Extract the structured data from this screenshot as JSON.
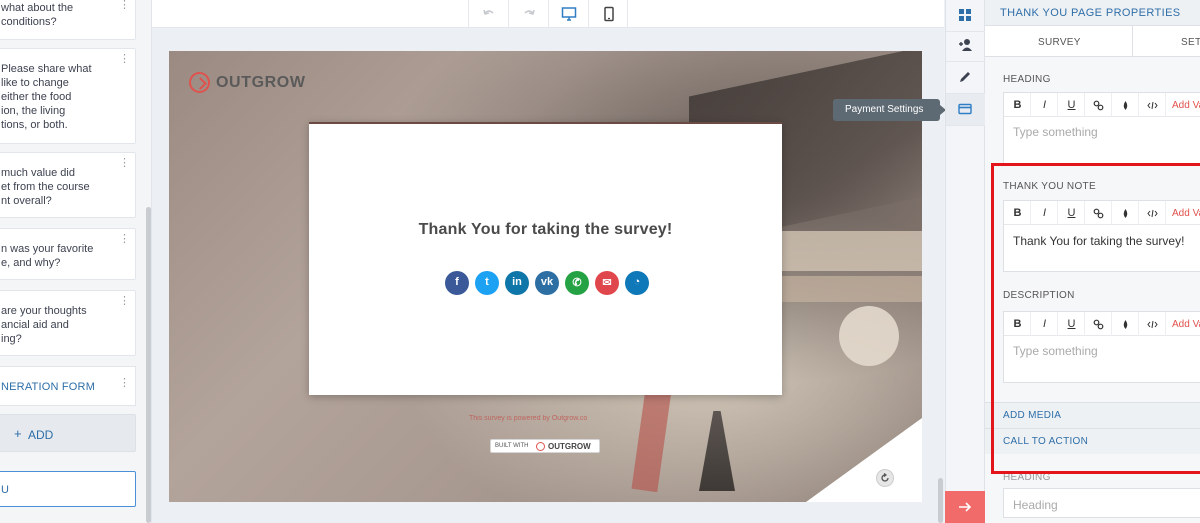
{
  "questions": [
    {
      "text": "what about the\nconditions?"
    },
    {
      "text": "Please share what\nlike to change\neither the food\nion, the living\ntions, or both."
    },
    {
      "text": "much value did\net from the course\nnt overall?"
    },
    {
      "text": "n was your favorite\ne, and why?"
    },
    {
      "text": "are your thoughts\nancial aid and\ning?"
    }
  ],
  "lead_gen_label": "NERATION FORM",
  "add_button": {
    "plus": "+",
    "label": "ADD"
  },
  "thank_field_label": "U",
  "toolbar": {
    "icons": [
      "undo-icon",
      "redo-icon",
      "desktop-icon",
      "mobile-icon"
    ]
  },
  "preview": {
    "brand": "OUTGROW",
    "title": "Thank You for taking the survey!",
    "share_buttons": [
      {
        "name": "facebook",
        "glyph": "f",
        "color": "#3b5998"
      },
      {
        "name": "twitter",
        "glyph": "t",
        "color": "#1da1f2"
      },
      {
        "name": "linkedin",
        "glyph": "in",
        "color": "#0e76a8"
      },
      {
        "name": "vk",
        "glyph": "vk",
        "color": "#2d6ea3"
      },
      {
        "name": "whatsapp",
        "glyph": "✆",
        "color": "#25a244"
      },
      {
        "name": "email",
        "glyph": "✉",
        "color": "#e0474c"
      },
      {
        "name": "messenger",
        "glyph": "◔",
        "color": "#0f78b8"
      }
    ],
    "powered_text": "This survey is powered by Outgrow.co",
    "built_with_label": "BUILT WITH",
    "built_with_brand": "OUTGROW"
  },
  "tooltip": "Payment Settings",
  "rail_icons": [
    "dashboard-icon",
    "add-user-icon",
    "pencil-icon",
    "card-icon"
  ],
  "props": {
    "title": "THANK YOU PAGE PROPERTIES",
    "tabs": [
      "SURVEY",
      "SETTINGS"
    ],
    "editor_buttons": [
      "B",
      "I",
      "U"
    ],
    "add_variable": "Add Variable",
    "sections": {
      "heading": {
        "label": "HEADING",
        "placeholder": "Type something"
      },
      "thank_you_note": {
        "label": "THANK YOU NOTE",
        "value": "Thank You for taking the survey!"
      },
      "description": {
        "label": "DESCRIPTION",
        "placeholder": "Type something"
      }
    },
    "add_media": "ADD MEDIA",
    "call_to_action": "CALL TO ACTION",
    "heading2": {
      "label": "HEADING",
      "placeholder": "Heading"
    }
  },
  "colors": {
    "accent": "#2e6ea8",
    "brand_red": "#e0524d",
    "highlight": "#e3151a",
    "next_button": "#f16b6b"
  }
}
